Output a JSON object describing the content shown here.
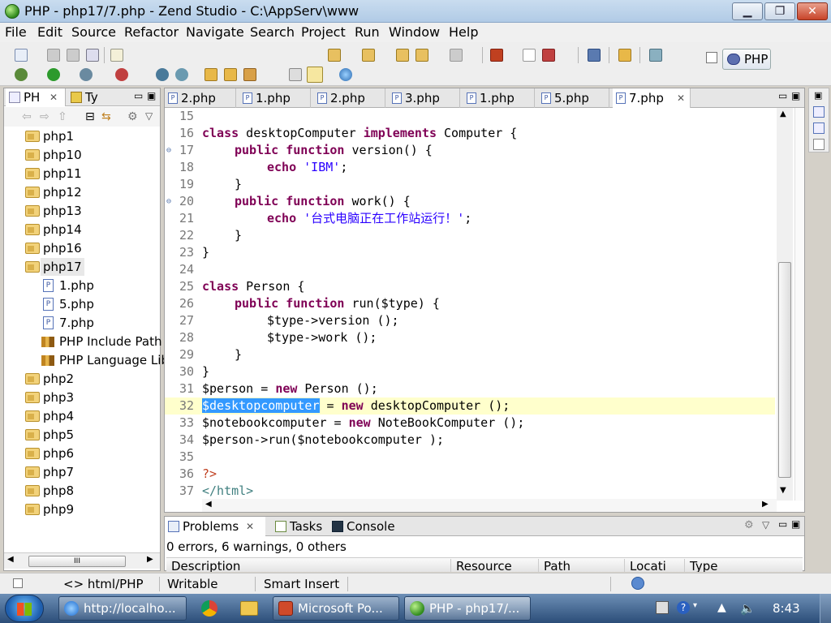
{
  "window": {
    "title": "PHP - php17/7.php - Zend Studio - C:\\AppServ\\www",
    "min": "▁",
    "max": "❐",
    "close": "✕"
  },
  "menu": [
    "File",
    "Edit",
    "Source",
    "Refactor",
    "Navigate",
    "Search",
    "Project",
    "Run",
    "Window",
    "Help"
  ],
  "perspective": {
    "label": "PHP"
  },
  "left_panel": {
    "tabs": [
      "PH",
      "Ty"
    ],
    "tree": [
      {
        "label": "php1",
        "type": "folder"
      },
      {
        "label": "php10",
        "type": "folder"
      },
      {
        "label": "php11",
        "type": "folder"
      },
      {
        "label": "php12",
        "type": "folder"
      },
      {
        "label": "php13",
        "type": "folder"
      },
      {
        "label": "php14",
        "type": "folder"
      },
      {
        "label": "php16",
        "type": "folder"
      },
      {
        "label": "php17",
        "type": "folder"
      },
      {
        "label": "1.php",
        "type": "file"
      },
      {
        "label": "5.php",
        "type": "file"
      },
      {
        "label": "7.php",
        "type": "file"
      },
      {
        "label": "PHP Include Path",
        "type": "lib"
      },
      {
        "label": "PHP Language Lib",
        "type": "lib"
      },
      {
        "label": "php2",
        "type": "folder"
      },
      {
        "label": "php3",
        "type": "folder"
      },
      {
        "label": "php4",
        "type": "folder"
      },
      {
        "label": "php5",
        "type": "folder"
      },
      {
        "label": "php6",
        "type": "folder"
      },
      {
        "label": "php7",
        "type": "folder"
      },
      {
        "label": "php8",
        "type": "folder"
      },
      {
        "label": "php9",
        "type": "folder"
      }
    ],
    "scroll_thumb": "III"
  },
  "editor": {
    "tabs": [
      "2.php",
      "1.php",
      "2.php",
      "3.php",
      "1.php",
      "5.php",
      "7.php"
    ],
    "active_tab": "7.php",
    "lines": [
      {
        "n": "15"
      },
      {
        "n": "16"
      },
      {
        "n": "17"
      },
      {
        "n": "18"
      },
      {
        "n": "19"
      },
      {
        "n": "20"
      },
      {
        "n": "21"
      },
      {
        "n": "22"
      },
      {
        "n": "23"
      },
      {
        "n": "24"
      },
      {
        "n": "25"
      },
      {
        "n": "26"
      },
      {
        "n": "27"
      },
      {
        "n": "28"
      },
      {
        "n": "29"
      },
      {
        "n": "30"
      },
      {
        "n": "31"
      },
      {
        "n": "32"
      },
      {
        "n": "33"
      },
      {
        "n": "34"
      },
      {
        "n": "35"
      },
      {
        "n": "36"
      },
      {
        "n": "37"
      }
    ],
    "code": {
      "l16": [
        "class",
        " desktopComputer ",
        "implements",
        " Computer {"
      ],
      "l17": [
        "public",
        " ",
        "function",
        " version() {"
      ],
      "l18": [
        "echo",
        " ",
        "'IBM'",
        ";"
      ],
      "l19": [
        "}"
      ],
      "l20": [
        "public",
        " ",
        "function",
        " work() {"
      ],
      "l21": [
        "echo",
        " ",
        "'台式电脑正在工作站运行！'",
        ";"
      ],
      "l22": [
        "}"
      ],
      "l23": [
        "}"
      ],
      "l25": [
        "class",
        " Person {"
      ],
      "l26": [
        "public",
        " ",
        "function",
        " run($type) {"
      ],
      "l27": [
        "$type->version ();"
      ],
      "l28": [
        "$type->work ();"
      ],
      "l29": [
        "}"
      ],
      "l30": [
        "}"
      ],
      "l31": [
        "$person = ",
        "new",
        " Person ();"
      ],
      "l32": [
        "$desktopcomputer",
        " = ",
        "new",
        " desktopComputer ();"
      ],
      "l33": [
        "$notebookcomputer = ",
        "new",
        " NoteBookComputer ();"
      ],
      "l34": [
        "$person->run($notebookcomputer );"
      ],
      "l36": [
        "?>"
      ],
      "l37": [
        "</html>"
      ]
    }
  },
  "bottom_panel": {
    "tabs": [
      "Problems",
      "Tasks",
      "Console"
    ],
    "summary": "0 errors, 6 warnings, 0 others",
    "columns": [
      "Description",
      "Resource",
      "Path",
      "Locati",
      "Type"
    ]
  },
  "status": {
    "context": "html/PHP",
    "mode": "Writable",
    "insert": "Smart Insert"
  },
  "taskbar": {
    "tasks": [
      "http://localho...",
      "Microsoft Po...",
      "PHP - php17/..."
    ],
    "clock": "8:43"
  }
}
